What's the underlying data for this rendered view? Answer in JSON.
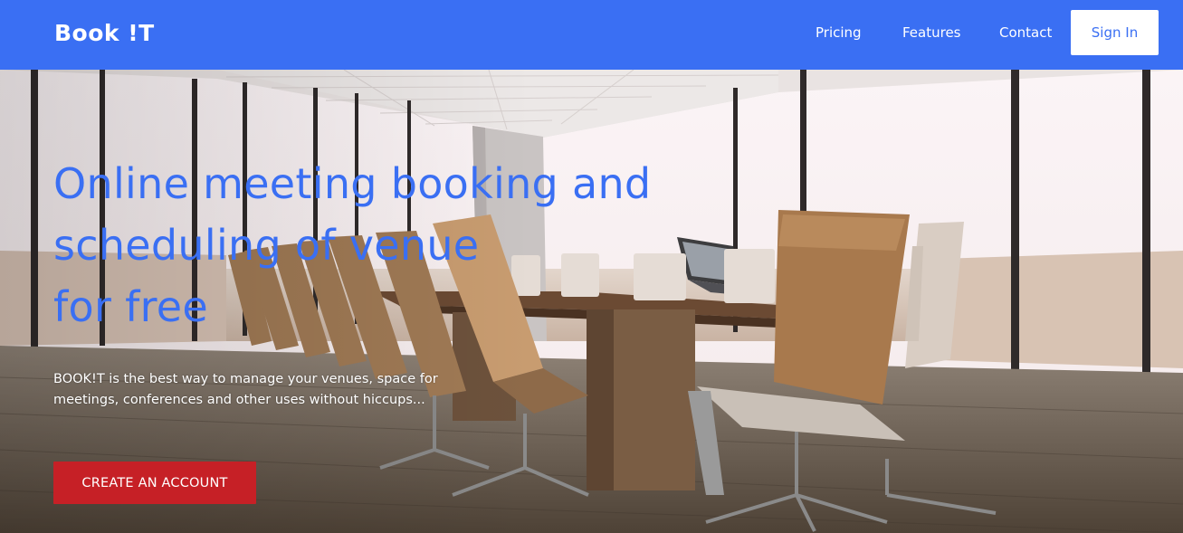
{
  "brand": {
    "name": "Book !T"
  },
  "nav": {
    "pricing": "Pricing",
    "features": "Features",
    "contact": "Contact",
    "sign_in": "Sign In"
  },
  "hero": {
    "title_lines": [
      "Online meeting booking and",
      "scheduling of venue",
      "for free"
    ],
    "description_lines": [
      "BOOK!T is the best way to manage your venues, space for",
      "meetings, conferences and other uses without hiccups..."
    ],
    "cta": "CREATE AN ACCOUNT"
  },
  "colors": {
    "primary": "#3a6ff3",
    "cta": "#c62026",
    "white": "#ffffff"
  },
  "icons": {
    "hero_image": "conference-room-photo"
  }
}
